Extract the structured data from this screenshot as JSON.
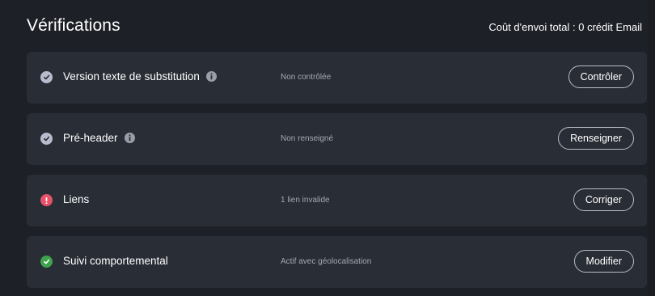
{
  "header": {
    "title": "Vérifications",
    "cost_text": "Coût d'envoi total : 0 crédit Email"
  },
  "checks": [
    {
      "label": "Version texte de substitution",
      "has_info": true,
      "status": "neutral",
      "status_color": "#b9bccd",
      "state_text": "Non contrôlée",
      "action_label": "Contrôler"
    },
    {
      "label": "Pré-header",
      "has_info": true,
      "status": "neutral",
      "status_color": "#b9bccd",
      "state_text": "Non renseigné",
      "action_label": "Renseigner"
    },
    {
      "label": "Liens",
      "has_info": false,
      "status": "error",
      "status_color": "#e8516b",
      "state_text": "1 lien invalide",
      "action_label": "Corriger"
    },
    {
      "label": "Suivi comportemental",
      "has_info": false,
      "status": "success",
      "status_color": "#3fa34d",
      "state_text": "Actif avec géolocalisation",
      "action_label": "Modifier"
    }
  ]
}
